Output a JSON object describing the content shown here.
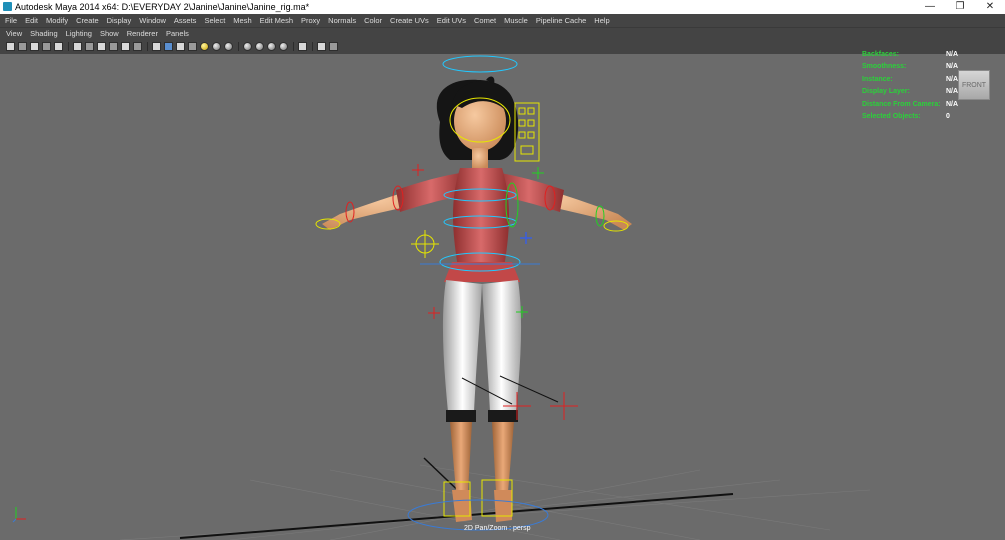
{
  "window": {
    "title": "Autodesk Maya 2014 x64: D:\\EVERYDAY 2\\Janine\\Janine\\Janine_rig.ma*",
    "controls": [
      "—",
      "❐",
      "✕"
    ]
  },
  "menubar": {
    "items": [
      "File",
      "Edit",
      "Modify",
      "Create",
      "Display",
      "Window",
      "Assets",
      "Select",
      "Mesh",
      "Edit Mesh",
      "Proxy",
      "Normals",
      "Color",
      "Create UVs",
      "Edit UVs",
      "Comet",
      "Muscle",
      "Pipeline Cache",
      "Help"
    ]
  },
  "panel_menu": {
    "items": [
      "View",
      "Shading",
      "Lighting",
      "Show",
      "Renderer",
      "Panels"
    ]
  },
  "toolbar": {
    "icons": [
      "select-camera-icon",
      "lock-camera-icon",
      "bookmark-icon",
      "image-plane-icon",
      "grid-view-icon",
      "film-gate-icon",
      "resolution-gate-icon",
      "gate-mask-icon",
      "field-chart-icon",
      "safe-action-icon",
      "safe-title-icon",
      "wireframe-icon",
      "smooth-shade-icon",
      "default-material-icon",
      "textured-icon",
      "use-all-lights-icon",
      "shadows-icon",
      "xray-icon",
      "xray-active-icon",
      "xray-joints-icon",
      "backface-icon",
      "isolate-select-icon",
      "resolution-icon",
      "hardware-texturing-icon",
      "camera-attributes-icon"
    ]
  },
  "hud": {
    "rows": [
      {
        "label": "Backfaces:",
        "value": "N/A"
      },
      {
        "label": "Smoothness:",
        "value": "N/A"
      },
      {
        "label": "Instance:",
        "value": "N/A"
      },
      {
        "label": "Display Layer:",
        "value": "N/A"
      },
      {
        "label": "Distance From Camera:",
        "value": "N/A"
      },
      {
        "label": "Selected Objects:",
        "value": "0"
      }
    ]
  },
  "viewcube": {
    "face": "FRONT"
  },
  "camera_label": "2D Pan/Zoom : persp",
  "colors": {
    "viewport_bg": "#6b6b6b",
    "hud_label": "#2bd13a",
    "control_yellow": "#e6e600",
    "control_cyan": "#22c8ff",
    "control_green": "#22d022",
    "control_red": "#e02020",
    "shirt": "#c24848",
    "pants": "#e4e4e4",
    "skin": "#f0b488",
    "hair": "#1a1a1a"
  }
}
